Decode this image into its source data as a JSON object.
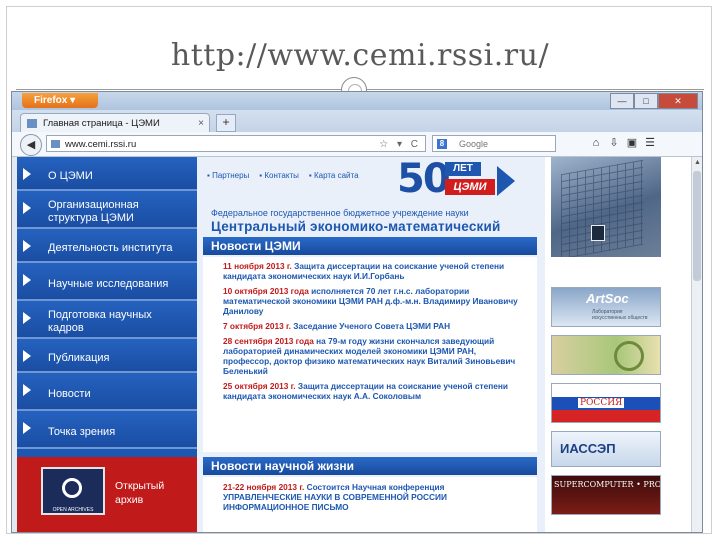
{
  "slide": {
    "title": "http://www.cemi.rssi.ru/"
  },
  "browser": {
    "app_button": "Firefox ▾",
    "window_controls": [
      "—",
      "□",
      "✕"
    ],
    "tab_title": "Главная страница - ЦЭМИ",
    "tab_close": "×",
    "new_tab": "+",
    "url": "www.cemi.rssi.ru",
    "url_icons": "☆ ▾ C",
    "search_engine": "8",
    "search_placeholder": "Google",
    "tools": [
      "⌂",
      "⇩",
      "▣",
      "☰"
    ]
  },
  "sidebar": {
    "items": [
      {
        "label": "О ЦЭМИ"
      },
      {
        "label": "Организационная структура ЦЭМИ"
      },
      {
        "label": "Деятельность института"
      },
      {
        "label": "Научные исследования"
      },
      {
        "label": "Подготовка научных кадров"
      },
      {
        "label": "Публикация"
      },
      {
        "label": "Новости"
      },
      {
        "label": "Точка зрения"
      }
    ],
    "archive_label": "Открытый архив",
    "archive_logo_caption": "OPEN ARCHIVES"
  },
  "header": {
    "links": [
      "Партнеры",
      "Контакты",
      "Карта сайта"
    ],
    "anniversary_number": "50",
    "anniversary_let": "ЛЕТ",
    "anniversary_org": "ЦЭМИ",
    "org_type": "Федеральное государственное бюджетное учреждение науки",
    "org_name": "Центральный экономико-математический"
  },
  "news": {
    "heading": "Новости ЦЭМИ",
    "items": [
      {
        "date": "11 ноября 2013 г.",
        "text": "Защита диссертации на соискание ученой степени кандидата экономических наук И.И.Горбань"
      },
      {
        "date": "10 октября 2013 года",
        "text": "исполняется 70 лет г.н.с. лаборатории математической экономики ЦЭМИ РАН д.ф.-м.н. Владимиру Ивановичу Данилову"
      },
      {
        "date": "7 октября 2013 г.",
        "text": "Заседание Ученого Совета ЦЭМИ РАН"
      },
      {
        "date": "28 сентября 2013 года",
        "text": "на 79-м году жизни скончался заведующий лабораторией динамических моделей экономики ЦЭМИ РАН, профессор, доктор физико математических наук Виталий Зиновьевич Беленький"
      },
      {
        "date": "25 октября 2013 г.",
        "text": "Защита диссертации на соискание ученой степени кандидата экономических наук А.А. Соколовым"
      }
    ]
  },
  "science_news": {
    "heading": "Новости научной жизни",
    "items": [
      {
        "date": "21-22 ноября 2013 г.",
        "text": "Состоится Научная конференция УПРАВЛЕНЧЕСКИЕ НАУКИ В СОВРЕМЕННОЙ РОССИИ"
      },
      {
        "date": "",
        "text": "ИНФОРМАЦИОННОЕ ПИСЬМО"
      }
    ]
  },
  "right_banners": {
    "artsoc": "ArtSoc",
    "artsoc_sub": "Лаборатория искусственных обществ",
    "russia": "РОССИЯ",
    "iassep": "ИАССЭП",
    "supercomputer": "SUPERCOMPUTER • PRO"
  }
}
